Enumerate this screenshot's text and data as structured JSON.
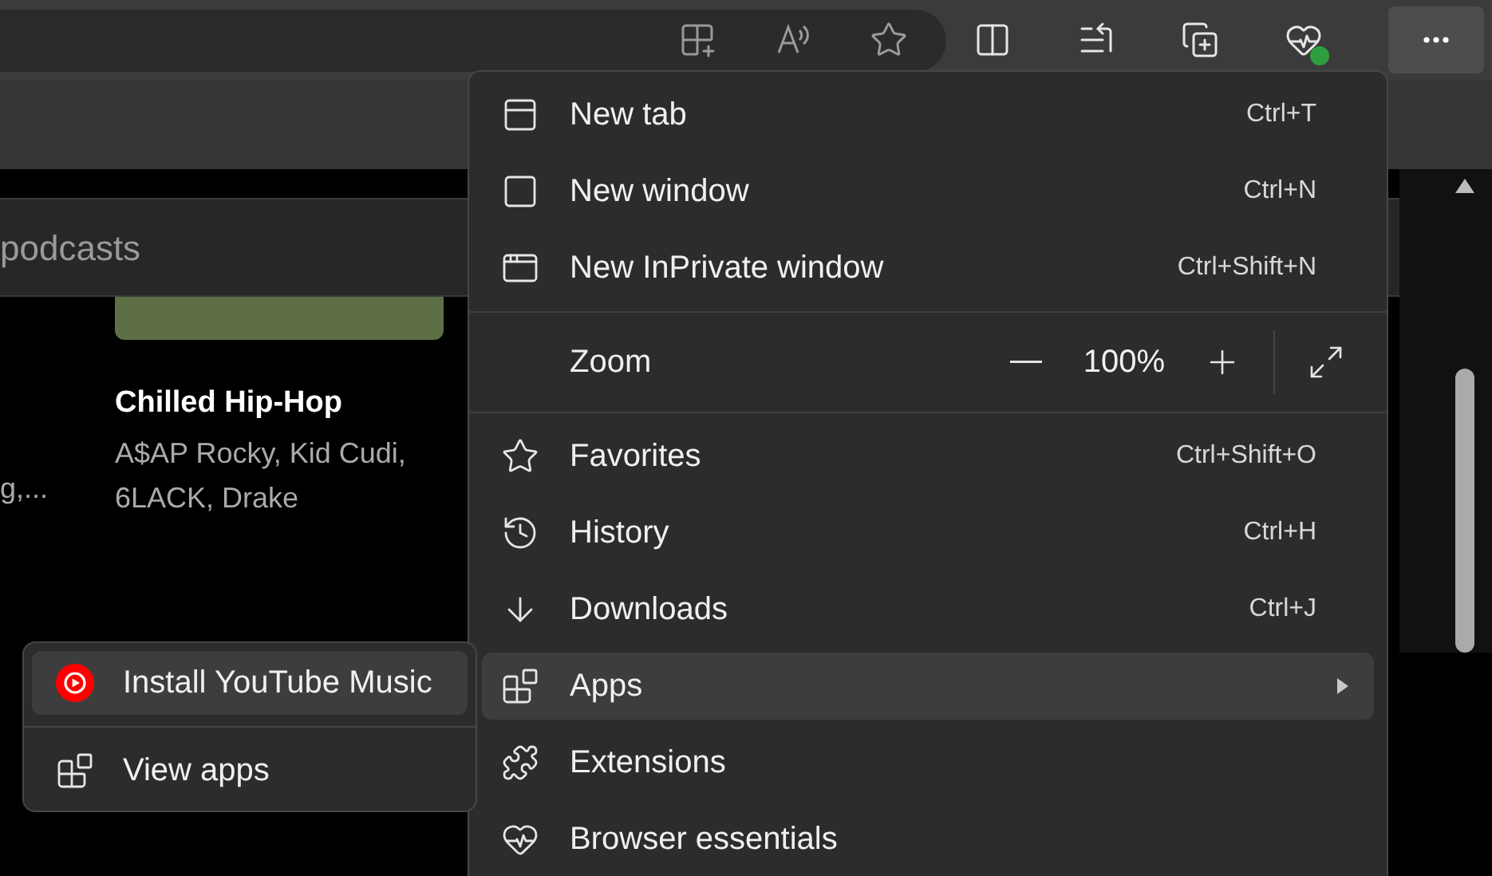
{
  "toolbar": {
    "more_button_active": true
  },
  "page": {
    "search_text": "podcasts",
    "card": {
      "title": "Chilled Hip-Hop",
      "subtitle_lines": [
        "A$AP Rocky, Kid Cudi,",
        "6LACK, Drake"
      ]
    },
    "cut_text": "g,..."
  },
  "menu": {
    "items": [
      {
        "kind": "item",
        "label": "New tab",
        "shortcut": "Ctrl+T",
        "selected": false
      },
      {
        "kind": "item",
        "label": "New window",
        "shortcut": "Ctrl+N",
        "selected": false
      },
      {
        "kind": "item",
        "label": "New InPrivate window",
        "shortcut": "Ctrl+Shift+N",
        "selected": false
      },
      {
        "kind": "divider"
      },
      {
        "kind": "zoom",
        "label": "Zoom",
        "value": "100%"
      },
      {
        "kind": "divider"
      },
      {
        "kind": "item",
        "label": "Favorites",
        "shortcut": "Ctrl+Shift+O",
        "selected": false
      },
      {
        "kind": "item",
        "label": "History",
        "shortcut": "Ctrl+H",
        "selected": false
      },
      {
        "kind": "item",
        "label": "Downloads",
        "shortcut": "Ctrl+J",
        "selected": false
      },
      {
        "kind": "submenu",
        "label": "Apps",
        "selected": true
      },
      {
        "kind": "item",
        "label": "Extensions",
        "selected": false
      },
      {
        "kind": "item",
        "label": "Browser essentials",
        "selected": false
      }
    ]
  },
  "submenu": {
    "items": [
      {
        "kind": "item",
        "label": "Install YouTube Music",
        "selected": true
      },
      {
        "kind": "divider"
      },
      {
        "kind": "item",
        "label": "View apps",
        "selected": false
      }
    ]
  }
}
